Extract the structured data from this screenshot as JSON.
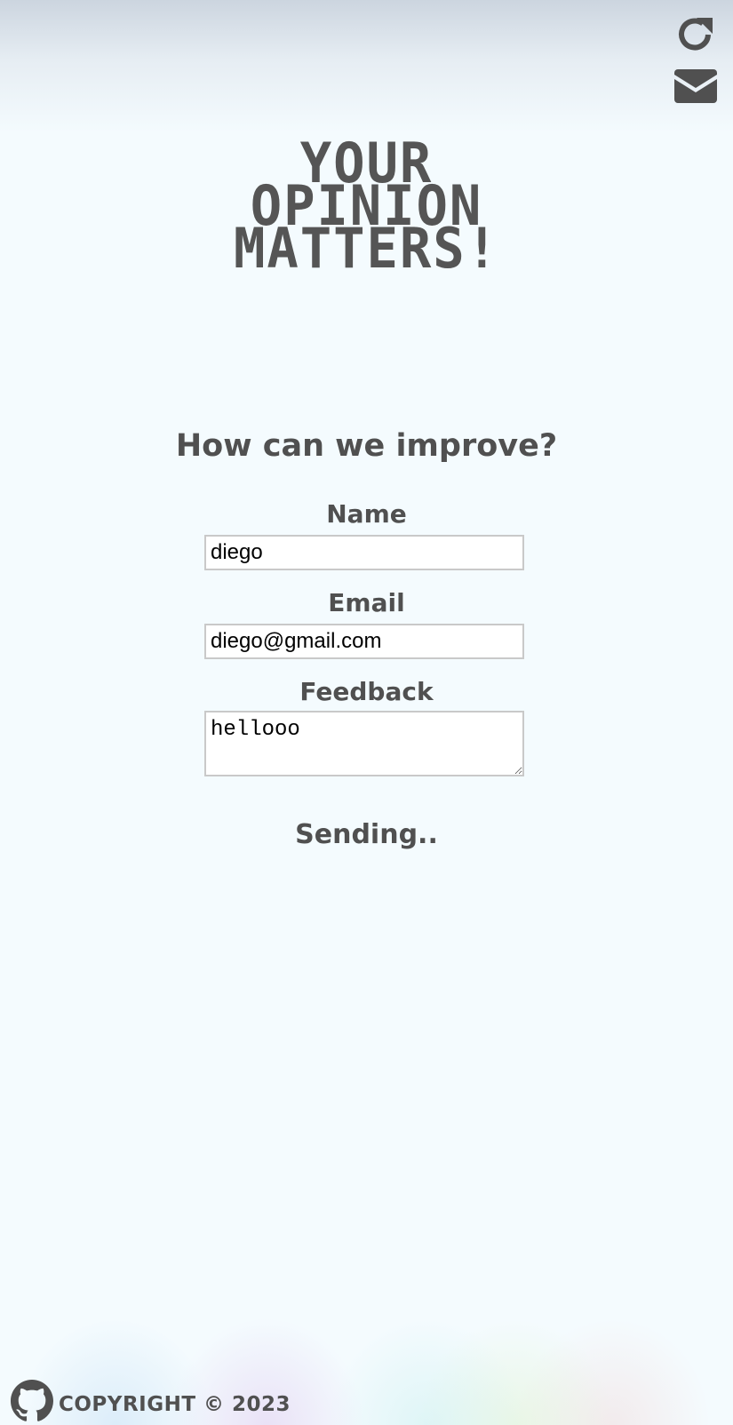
{
  "header": {
    "refresh_icon": "refresh-icon",
    "mail_icon": "mail-icon"
  },
  "hero": {
    "line1": "YOUR",
    "line2": "OPINION",
    "line3": "MATTERS!"
  },
  "form": {
    "heading": "How can we improve?",
    "name_label": "Name",
    "name_value": "diego",
    "email_label": "Email",
    "email_value": "diego@gmail.com",
    "feedback_label": "Feedback",
    "feedback_value": "hellooo"
  },
  "status": {
    "text": "Sending.."
  },
  "footer": {
    "github_icon": "github-icon",
    "copyright": "COPYRIGHT © 2023"
  },
  "colors": {
    "text": "#505050",
    "background": "#f4fbfe",
    "input_border": "#c9c9c9"
  }
}
